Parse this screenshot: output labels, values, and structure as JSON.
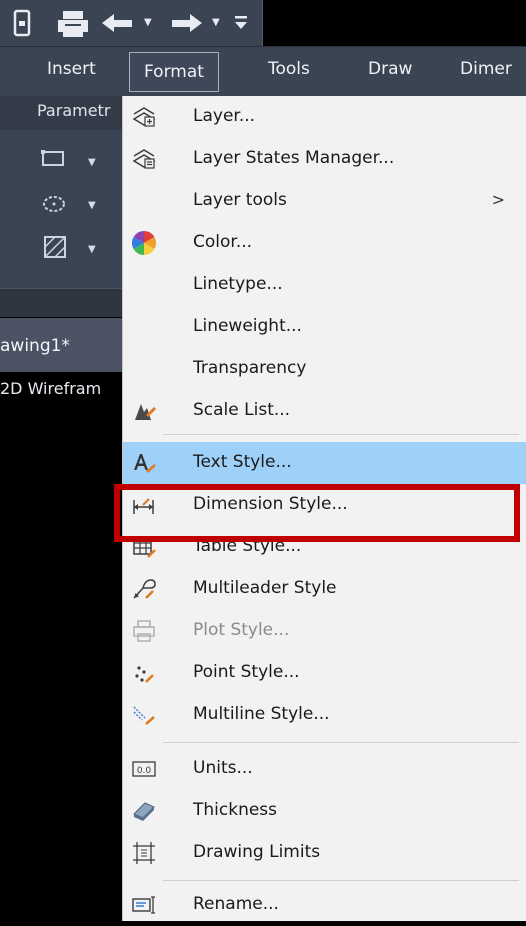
{
  "menubar": {
    "items": [
      "Insert",
      "Format",
      "Tools",
      "Draw",
      "Dimer"
    ]
  },
  "ribbon": {
    "tab_label": "Parametr"
  },
  "document": {
    "tab": "awing1*",
    "view_label": "2D Wirefram"
  },
  "menu": {
    "items": [
      {
        "label": "Layer...",
        "icon": "layer-icon"
      },
      {
        "label": "Layer States Manager...",
        "icon": "layer-states-icon"
      },
      {
        "label": "Layer tools",
        "icon": "",
        "submenu": true,
        "arrow": ">"
      },
      {
        "label": "Color...",
        "icon": "color-wheel-icon"
      },
      {
        "label": "Linetype...",
        "icon": ""
      },
      {
        "label": "Lineweight...",
        "icon": ""
      },
      {
        "label": "Transparency",
        "icon": ""
      },
      {
        "label": "Scale List...",
        "icon": "scale-list-icon"
      },
      {
        "label": "Text Style...",
        "icon": "text-style-icon",
        "highlighted": true
      },
      {
        "label": "Dimension Style...",
        "icon": "dimension-style-icon"
      },
      {
        "label": "Table Style...",
        "icon": "table-style-icon"
      },
      {
        "label": "Multileader Style",
        "icon": "multileader-style-icon"
      },
      {
        "label": "Plot Style...",
        "icon": "plot-style-icon",
        "disabled": true
      },
      {
        "label": "Point Style...",
        "icon": "point-style-icon"
      },
      {
        "label": "Multiline Style...",
        "icon": "multiline-style-icon"
      },
      {
        "label": "Units...",
        "icon": "units-icon"
      },
      {
        "label": "Thickness",
        "icon": "thickness-icon"
      },
      {
        "label": "Drawing Limits",
        "icon": "drawing-limits-icon"
      },
      {
        "label": "Rename...",
        "icon": "rename-icon"
      }
    ]
  },
  "colors": {
    "menu_bg": "#f2f2f2",
    "highlight": "#9fd0f8",
    "callout": "#c00000",
    "chrome": "#3b4453"
  }
}
